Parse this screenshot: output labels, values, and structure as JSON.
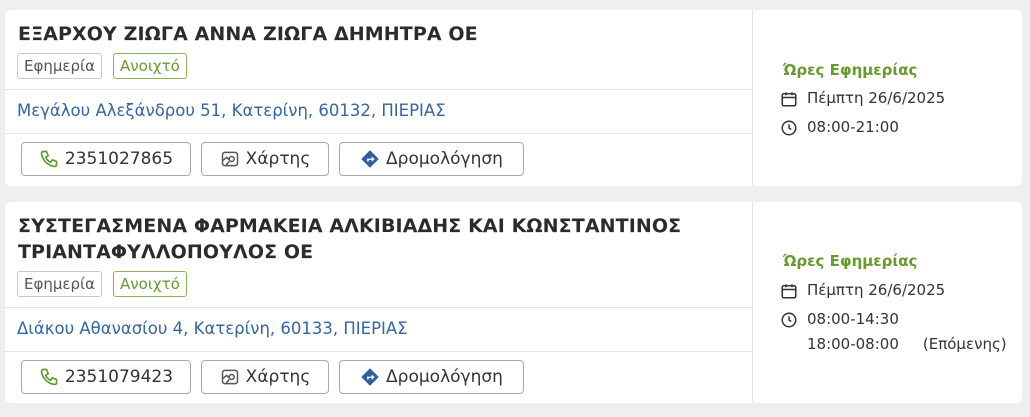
{
  "pharmacies": [
    {
      "name": "ΕΞΑΡΧΟΥ ΖΙΩΓΑ ΑΝΝΑ ΖΙΩΓΑ ΔΗΜΗΤΡΑ ΟΕ",
      "badge_duty": "Εφημερία",
      "badge_status": "Ανοιχτό",
      "address": "Μεγάλου Αλεξάνδρου 51, Κατερίνη, 60132, ΠΙΕΡΙΑΣ",
      "phone": "2351027865",
      "map_label": "Χάρτης",
      "route_label": "Δρομολόγηση",
      "hours_title": "Ώρες Εφημερίας",
      "date": "Πέμπτη 26/6/2025",
      "time1": "08:00-21:00"
    },
    {
      "name_line1": "ΣΥΣΤΕΓΑΣΜΕΝΑ ΦΑΡΜΑΚΕΙΑ ΑΛΚΙΒΙΑΔΗΣ ΚΑΙ ΚΩΝΣΤΑΝΤΙΝΟΣ",
      "name_line2": "ΤΡΙΑΝΤΑΦΥΛΛΟΠΟΥΛΟΣ ΟΕ",
      "badge_duty": "Εφημερία",
      "badge_status": "Ανοιχτό",
      "address": "Διάκου Αθανασίου 4, Κατερίνη, 60133, ΠΙΕΡΙΑΣ",
      "phone": "2351079423",
      "map_label": "Χάρτης",
      "route_label": "Δρομολόγηση",
      "hours_title": "Ώρες Εφημερίας",
      "date": "Πέμπτη 26/6/2025",
      "time1": "08:00-14:30",
      "time2": "18:00-08:00",
      "time2_note": "(Επόμενης)"
    }
  ],
  "icons": {
    "phone": "phone-icon",
    "map": "map-icon",
    "route": "directions-icon",
    "calendar": "calendar-icon",
    "clock": "clock-icon"
  },
  "colors": {
    "accent_green": "#6a9a2f",
    "link_blue": "#3366a3",
    "route_blue": "#2f5fa0"
  }
}
